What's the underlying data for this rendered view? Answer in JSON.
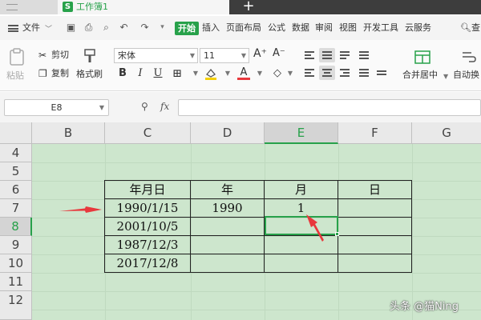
{
  "titlebar": {
    "doc_title": "工作簿1",
    "app_icon": "S",
    "new_tab": "+"
  },
  "menu": {
    "file": "文件",
    "start": "开始",
    "tabs": [
      "插入",
      "页面布局",
      "公式",
      "数据",
      "审阅",
      "视图",
      "开发工具",
      "云服务"
    ],
    "search": "查"
  },
  "ribbon": {
    "paste": "粘贴",
    "cut": "剪切",
    "copy": "复制",
    "format_painter": "格式刷",
    "font_name": "宋体",
    "font_size": "11",
    "merge_center": "合并居中",
    "auto_wrap": "自动换"
  },
  "formula_bar": {
    "cell_ref": "E8",
    "fx": "fx",
    "content": ""
  },
  "columns": [
    "B",
    "C",
    "D",
    "E",
    "F",
    "G"
  ],
  "active_column": "E",
  "rows": [
    "4",
    "5",
    "6",
    "7",
    "8",
    "9",
    "10",
    "11",
    "12"
  ],
  "active_row": "8",
  "table": {
    "headers": [
      "年月日",
      "年",
      "月",
      "日"
    ],
    "rows": [
      [
        "1990/1/15",
        "1990",
        "1",
        ""
      ],
      [
        "2001/10/5",
        "",
        "",
        ""
      ],
      [
        "1987/12/3",
        "",
        "",
        ""
      ],
      [
        "2017/12/8",
        "",
        "",
        ""
      ]
    ]
  },
  "colors": {
    "accent": "#27a14a",
    "grid_bg": "#cde6cd",
    "arrow": "#e8383d"
  },
  "watermark": "头条 @猫Ning"
}
